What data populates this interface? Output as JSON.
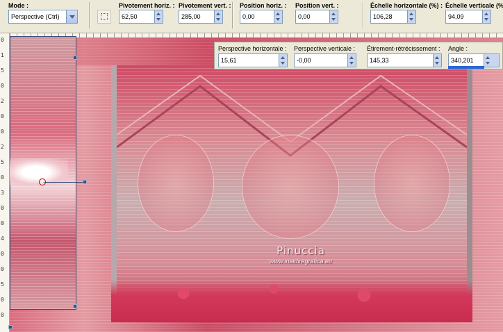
{
  "toolbar": {
    "mode_label": "Mode :",
    "mode_value": "Perspective (Ctrl)",
    "pivot_h_label": "Pivotement horiz. :",
    "pivot_h_value": "62,50",
    "pivot_v_label": "Pivotement vert. :",
    "pivot_v_value": "285,00",
    "pos_h_label": "Position horiz. :",
    "pos_h_value": "0,00",
    "pos_v_label": "Position vert. :",
    "pos_v_value": "0,00",
    "scale_h_label": "Échelle horizontale (%) :",
    "scale_h_value": "106,28",
    "scale_v_label": "Échelle verticale (%",
    "scale_v_value": "94,09"
  },
  "subbar": {
    "persp_h_label": "Perspective horizontale :",
    "persp_h_value": "15,61",
    "persp_v_label": "Perspective verticale :",
    "persp_v_value": "-0,00",
    "stretch_label": "Étirement-rétrécissement :",
    "stretch_value": "145,33",
    "angle_label": "Angle :",
    "angle_value": "340,201"
  },
  "ruler_ticks": [
    "0",
    "1",
    "5",
    "0",
    "2",
    "0",
    "0",
    "2",
    "5",
    "0",
    "3",
    "0",
    "0",
    "4",
    "0",
    "0",
    "5",
    "0",
    "0"
  ],
  "watermark": {
    "name": "Pinuccia",
    "url": "www.inaidiregrafica.eu"
  },
  "icons": {
    "tool": "perspective-tool-icon",
    "dropdown": "chevron-down-icon"
  },
  "colors": {
    "accent": "#2d66d3",
    "handle": "#3a5078"
  }
}
